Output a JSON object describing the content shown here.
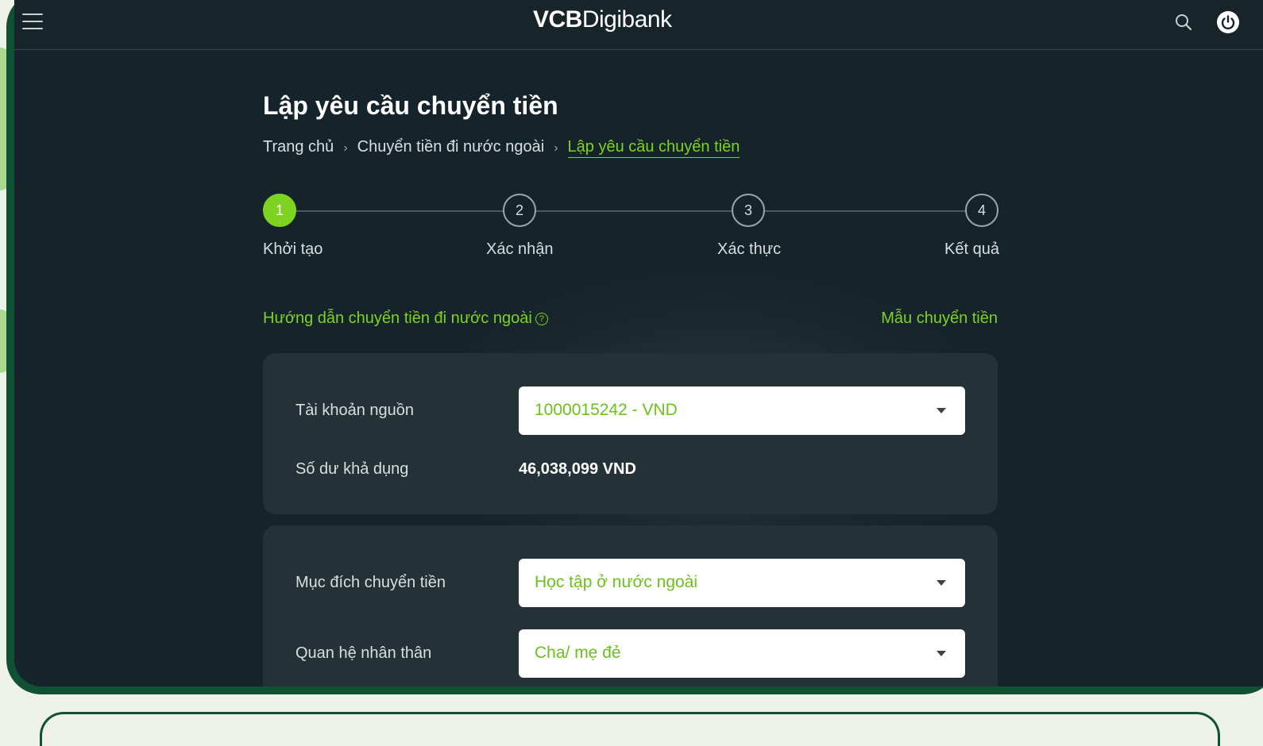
{
  "app": {
    "logo_bold": "VCB",
    "logo_light": "Digibank"
  },
  "page": {
    "title": "Lập yêu cầu chuyển tiền",
    "breadcrumb": [
      "Trang chủ",
      "Chuyển tiền đi nước ngoài",
      "Lập yêu cầu chuyển tiền"
    ]
  },
  "steps": [
    {
      "number": "1",
      "label": "Khởi tạo",
      "active": true
    },
    {
      "number": "2",
      "label": "Xác nhận",
      "active": false
    },
    {
      "number": "3",
      "label": "Xác thực",
      "active": false
    },
    {
      "number": "4",
      "label": "Kết quả",
      "active": false
    }
  ],
  "links": {
    "guide": "Hướng dẫn chuyển tiền đi nước ngoài",
    "guide_help": "?",
    "template": "Mẫu chuyển tiền"
  },
  "account_card": {
    "source_label": "Tài khoản nguồn",
    "source_value": "1000015242 - VND",
    "balance_label": "Số dư khả dụng",
    "balance_value": "46,038,099 VND"
  },
  "purpose_card": {
    "purpose_label": "Mục đích chuyển tiền",
    "purpose_value": "Học tập ở nước ngoài",
    "relation_label": "Quan hệ nhân thân",
    "relation_value": "Cha/ mẹ đẻ"
  },
  "colors": {
    "accent": "#7ed321",
    "background": "#15232a",
    "card": "#243238",
    "frame": "#0f5132"
  }
}
